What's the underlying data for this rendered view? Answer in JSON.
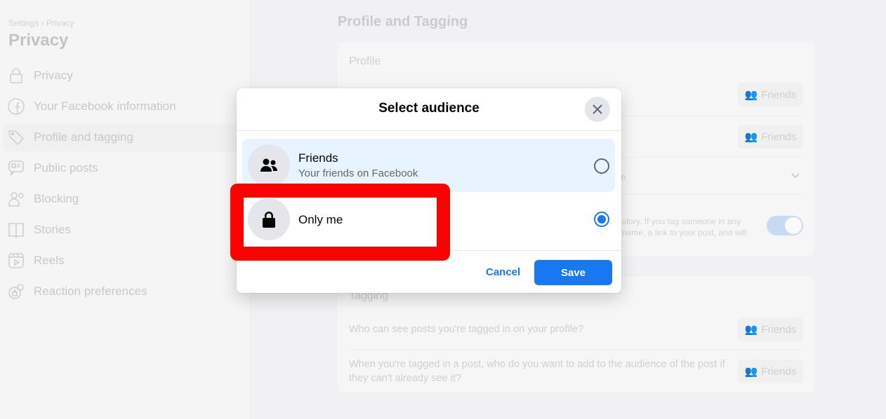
{
  "sidebar": {
    "breadcrumb": "Settings › Privacy",
    "title": "Privacy",
    "items": [
      {
        "label": "Privacy",
        "icon": "lock-icon"
      },
      {
        "label": "Your Facebook information",
        "icon": "facebook-icon"
      },
      {
        "label": "Profile and tagging",
        "icon": "tag-icon",
        "active": true
      },
      {
        "label": "Public posts",
        "icon": "public-posts-icon"
      },
      {
        "label": "Blocking",
        "icon": "blocking-icon"
      },
      {
        "label": "Stories",
        "icon": "book-icon"
      },
      {
        "label": "Reels",
        "icon": "reels-icon"
      },
      {
        "label": "Reaction preferences",
        "icon": "reaction-icon"
      }
    ]
  },
  "main": {
    "title": "Profile and Tagging",
    "profile_card": {
      "heading": "Profile",
      "buttons": [
        "Friends",
        "Friends"
      ],
      "fragment_row3": "le",
      "fragment_row4_line1": "story. If you tag someone in any",
      "fragment_row4_line2": "name, a link to your post, and will",
      "toggle_on": true
    },
    "tagging_card": {
      "heading": "Tagging",
      "rows": [
        {
          "text": "Who can see posts you're tagged in on your profile?",
          "button": "Friends"
        },
        {
          "text": "When you're tagged in a post, who do you want to add to the audience of the post if they can't already see it?",
          "button": "Friends"
        }
      ]
    }
  },
  "dialog": {
    "title": "Select audience",
    "options": [
      {
        "name": "Friends",
        "description": "Your friends on Facebook",
        "icon": "friends-icon",
        "selected": false
      },
      {
        "name": "Only me",
        "icon": "lock-icon",
        "selected": true
      }
    ],
    "cancel_label": "Cancel",
    "save_label": "Save"
  },
  "colors": {
    "accent": "#1877f2",
    "highlight": "#e7f3ff",
    "annotation": "#ff0000"
  }
}
